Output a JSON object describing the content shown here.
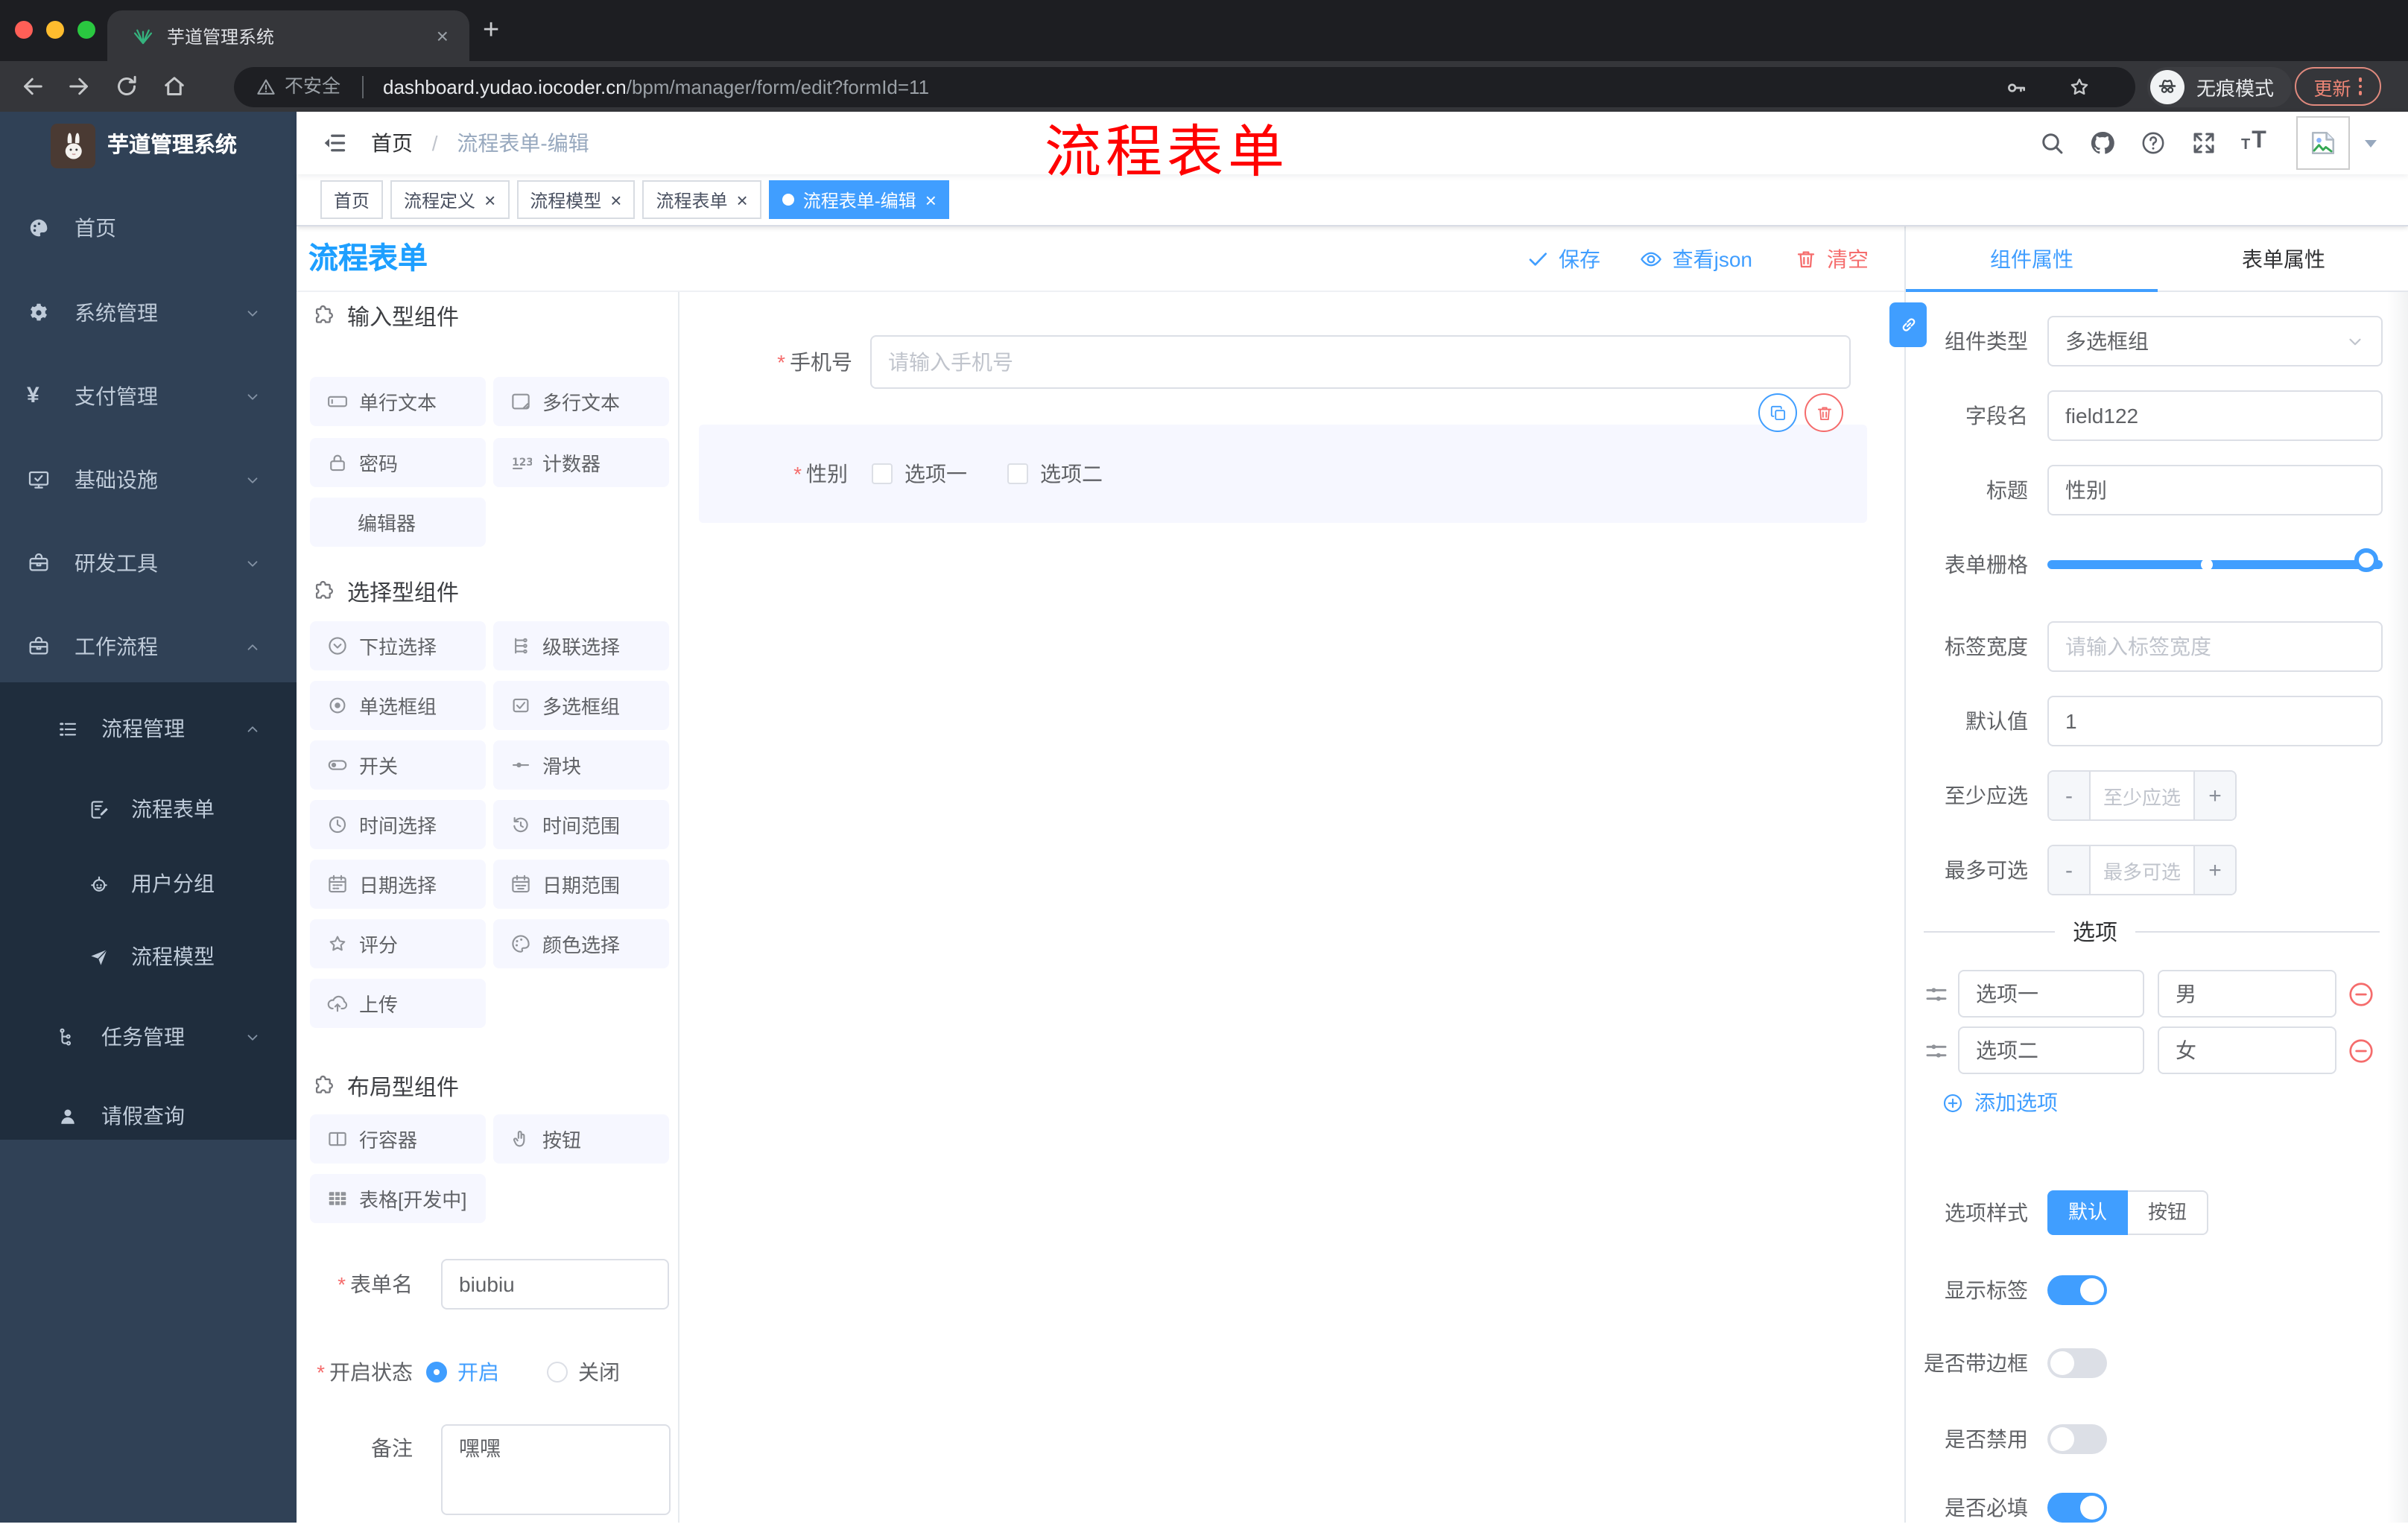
{
  "colors": {
    "primary": "#409eff",
    "danger": "#f56c6c",
    "title_blue": "#1e9fff",
    "annotation_red": "#ff0000",
    "sidebar_bg": "#304156",
    "submenu_bg": "#1f2d3d"
  },
  "browser": {
    "tab_title": "芋道管理系统",
    "close_tab": "×",
    "new_tab": "+",
    "security_label": "不安全",
    "url_host": "dashboard.yudao.iocoder.cn",
    "url_path": "/bpm/manager/form/edit?formId=11",
    "incognito_label": "无痕模式",
    "update_label": "更新"
  },
  "sidebar": {
    "logo_title": "芋道管理系统",
    "menu": [
      {
        "label": "首页",
        "icon": "dashboard"
      },
      {
        "label": "系统管理",
        "icon": "gear"
      },
      {
        "label": "支付管理",
        "icon": "yen"
      },
      {
        "label": "基础设施",
        "icon": "monitor"
      },
      {
        "label": "研发工具",
        "icon": "toolbox"
      },
      {
        "label": "工作流程",
        "icon": "toolbox"
      }
    ],
    "submenu": [
      {
        "label": "流程管理",
        "icon": "list-menu"
      },
      {
        "label": "流程表单",
        "icon": "doc-edit"
      },
      {
        "label": "用户分组",
        "icon": "robot"
      },
      {
        "label": "流程模型",
        "icon": "send"
      },
      {
        "label": "任务管理",
        "icon": "tree"
      },
      {
        "label": "请假查询",
        "icon": "user"
      }
    ]
  },
  "header": {
    "breadcrumb_home": "首页",
    "breadcrumb_sep": "/",
    "breadcrumb_current": "流程表单-编辑",
    "annotation": "流程表单"
  },
  "tags": [
    {
      "label": "首页"
    },
    {
      "label": "流程定义",
      "close": "×"
    },
    {
      "label": "流程模型",
      "close": "×"
    },
    {
      "label": "流程表单",
      "close": "×"
    },
    {
      "label": "流程表单-编辑",
      "close": "×"
    }
  ],
  "toolbar": {
    "title": "流程表单",
    "save": "保存",
    "view_json": "查看json",
    "clear": "清空"
  },
  "palette": {
    "sections": [
      {
        "title": "输入型组件",
        "items": [
          {
            "label": "单行文本",
            "icon": "input"
          },
          {
            "label": "多行文本",
            "icon": "textarea"
          },
          {
            "label": "密码",
            "icon": "lock"
          },
          {
            "label": "计数器",
            "icon": "counter"
          },
          {
            "label": "编辑器",
            "icon": "none"
          }
        ]
      },
      {
        "title": "选择型组件",
        "items": [
          {
            "label": "下拉选择",
            "icon": "select"
          },
          {
            "label": "级联选择",
            "icon": "cascader"
          },
          {
            "label": "单选框组",
            "icon": "radio"
          },
          {
            "label": "多选框组",
            "icon": "checkbox"
          },
          {
            "label": "开关",
            "icon": "switch"
          },
          {
            "label": "滑块",
            "icon": "slider"
          },
          {
            "label": "时间选择",
            "icon": "time"
          },
          {
            "label": "时间范围",
            "icon": "time-range"
          },
          {
            "label": "日期选择",
            "icon": "date"
          },
          {
            "label": "日期范围",
            "icon": "date-range"
          },
          {
            "label": "评分",
            "icon": "star"
          },
          {
            "label": "颜色选择",
            "icon": "color"
          },
          {
            "label": "上传",
            "icon": "upload"
          }
        ]
      },
      {
        "title": "布局型组件",
        "items": [
          {
            "label": "行容器",
            "icon": "row"
          },
          {
            "label": "按钮",
            "icon": "click"
          },
          {
            "label": "表格[开发中]",
            "icon": "table"
          }
        ]
      }
    ],
    "form": {
      "name_label": "表单名",
      "name_value": "biubiu",
      "status_label": "开启状态",
      "status_on": "开启",
      "status_off": "关闭",
      "remark_label": "备注",
      "remark_value": "嘿嘿"
    }
  },
  "canvas": {
    "phone": {
      "label": "手机号",
      "placeholder": "请输入手机号"
    },
    "gender": {
      "label": "性别",
      "options": [
        "选项一",
        "选项二"
      ]
    }
  },
  "panel": {
    "tab_component": "组件属性",
    "tab_form": "表单属性",
    "component_type": {
      "label": "组件类型",
      "value": "多选框组"
    },
    "field_name": {
      "label": "字段名",
      "value": "field122"
    },
    "title": {
      "label": "标题",
      "value": "性别"
    },
    "form_grid": {
      "label": "表单栅格"
    },
    "label_width": {
      "label": "标签宽度",
      "placeholder": "请输入标签宽度"
    },
    "default_value": {
      "label": "默认值",
      "value": "1"
    },
    "min_select": {
      "label": "至少应选",
      "placeholder": "至少应选"
    },
    "max_select": {
      "label": "最多可选",
      "placeholder": "最多可选"
    },
    "options_title": "选项",
    "options": [
      {
        "name": "选项一",
        "value": "男"
      },
      {
        "name": "选项二",
        "value": "女"
      }
    ],
    "add_option": "添加选项",
    "option_style": {
      "label": "选项样式",
      "default": "默认",
      "button": "按钮"
    },
    "toggles": [
      {
        "label": "显示标签",
        "on": true
      },
      {
        "label": "是否带边框",
        "on": false
      },
      {
        "label": "是否禁用",
        "on": false
      },
      {
        "label": "是否必填",
        "on": true
      }
    ]
  }
}
